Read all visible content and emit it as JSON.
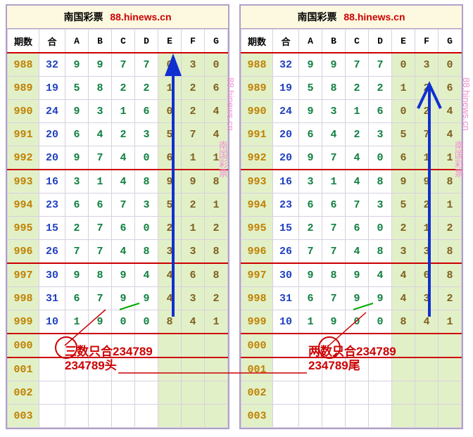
{
  "title": {
    "site": "南国彩票",
    "url": "88.hinews.cn"
  },
  "watermark": {
    "site": "南国彩票",
    "url": "88.hinews.cn"
  },
  "headers": [
    "期数",
    "合",
    "A",
    "B",
    "C",
    "D",
    "E",
    "F",
    "G"
  ],
  "chart_data": {
    "type": "table",
    "title": "南国彩票 88.hinews.cn",
    "columns": [
      "期数",
      "合",
      "A",
      "B",
      "C",
      "D",
      "E",
      "F",
      "G"
    ],
    "rows": [
      {
        "issue": "988",
        "he": "32",
        "a": "9",
        "b": "9",
        "c": "7",
        "d": "7",
        "e": "0",
        "f": "3",
        "g": "0"
      },
      {
        "issue": "989",
        "he": "19",
        "a": "5",
        "b": "8",
        "c": "2",
        "d": "2",
        "e": "1",
        "f": "2",
        "g": "6"
      },
      {
        "issue": "990",
        "he": "24",
        "a": "9",
        "b": "3",
        "c": "1",
        "d": "6",
        "e": "0",
        "f": "2",
        "g": "4"
      },
      {
        "issue": "991",
        "he": "20",
        "a": "6",
        "b": "4",
        "c": "2",
        "d": "3",
        "e": "5",
        "f": "7",
        "g": "4"
      },
      {
        "issue": "992",
        "he": "20",
        "a": "9",
        "b": "7",
        "c": "4",
        "d": "0",
        "e": "6",
        "f": "1",
        "g": "1"
      },
      {
        "issue": "993",
        "he": "16",
        "a": "3",
        "b": "1",
        "c": "4",
        "d": "8",
        "e": "9",
        "f": "9",
        "g": "8"
      },
      {
        "issue": "994",
        "he": "23",
        "a": "6",
        "b": "6",
        "c": "7",
        "d": "3",
        "e": "5",
        "f": "2",
        "g": "1"
      },
      {
        "issue": "995",
        "he": "15",
        "a": "2",
        "b": "7",
        "c": "6",
        "d": "0",
        "e": "2",
        "f": "1",
        "g": "2"
      },
      {
        "issue": "996",
        "he": "26",
        "a": "7",
        "b": "7",
        "c": "4",
        "d": "8",
        "e": "3",
        "f": "3",
        "g": "8"
      },
      {
        "issue": "997",
        "he": "30",
        "a": "9",
        "b": "8",
        "c": "9",
        "d": "4",
        "e": "4",
        "f": "6",
        "g": "8"
      },
      {
        "issue": "998",
        "he": "31",
        "a": "6",
        "b": "7",
        "c": "9",
        "d": "9",
        "e": "4",
        "f": "3",
        "g": "2"
      },
      {
        "issue": "999",
        "he": "10",
        "a": "1",
        "b": "9",
        "c": "0",
        "d": "0",
        "e": "8",
        "f": "4",
        "g": "1"
      },
      {
        "issue": "000",
        "he": "",
        "a": "",
        "b": "",
        "c": "",
        "d": "",
        "e": "",
        "f": "",
        "g": ""
      },
      {
        "issue": "001",
        "he": "",
        "a": "",
        "b": "",
        "c": "",
        "d": "",
        "e": "",
        "f": "",
        "g": ""
      },
      {
        "issue": "002",
        "he": "",
        "a": "",
        "b": "",
        "c": "",
        "d": "",
        "e": "",
        "f": "",
        "g": ""
      },
      {
        "issue": "003",
        "he": "",
        "a": "",
        "b": "",
        "c": "",
        "d": "",
        "e": "",
        "f": "",
        "g": ""
      }
    ]
  },
  "anno": {
    "left1": "三数只合234789",
    "left2": "234789头",
    "right1": "两数只合234789",
    "right2": "234789尾"
  }
}
